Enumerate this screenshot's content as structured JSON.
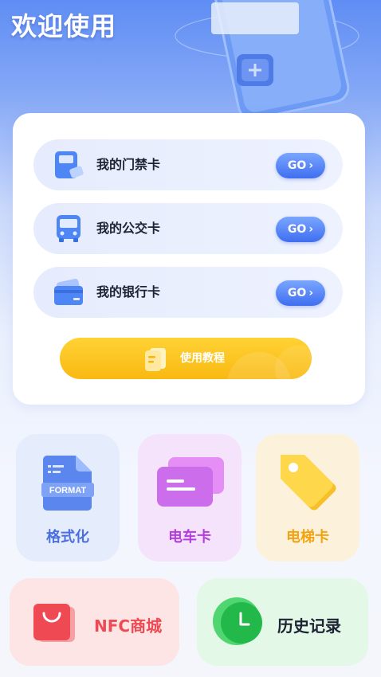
{
  "header": {
    "title": "欢迎使用"
  },
  "cards": [
    {
      "label": "我的门禁卡",
      "icon": "access-card-icon",
      "action": "GO"
    },
    {
      "label": "我的公交卡",
      "icon": "bus-icon",
      "action": "GO"
    },
    {
      "label": "我的银行卡",
      "icon": "bank-card-icon",
      "action": "GO"
    }
  ],
  "tutorial": {
    "label": "使用教程",
    "icon": "document-icon"
  },
  "tiles": [
    {
      "label": "格式化",
      "icon": "format-file-icon",
      "icon_text": "FORMAT",
      "color": "#4b6fe0"
    },
    {
      "label": "电车卡",
      "icon": "tram-card-icon",
      "color": "#b53ddd"
    },
    {
      "label": "电梯卡",
      "icon": "tag-icon",
      "color": "#f3a311"
    }
  ],
  "wide_tiles": [
    {
      "label": "NFC商城",
      "icon": "shopping-bag-icon",
      "color": "#ef4a53"
    },
    {
      "label": "历史记录",
      "icon": "clock-icon",
      "color": "#1d2235"
    }
  ],
  "colors": {
    "primary": "#4774ee",
    "accent_yellow": "#fbc21f"
  }
}
